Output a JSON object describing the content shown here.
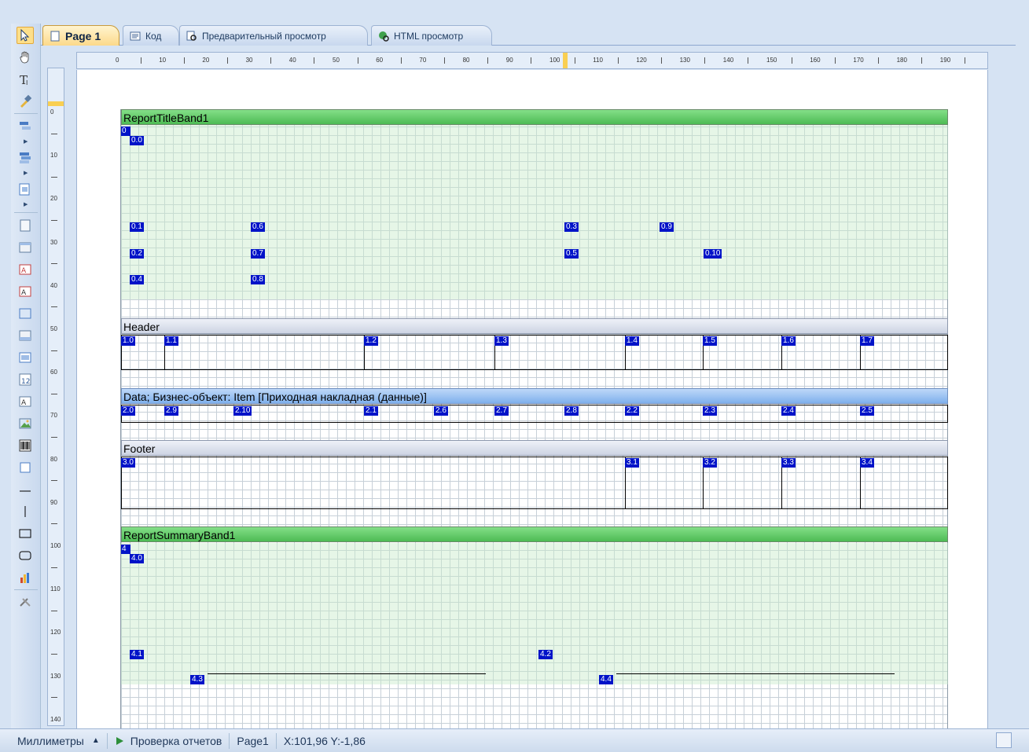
{
  "tabs": [
    {
      "label": "Page 1",
      "active": true
    },
    {
      "label": "Код"
    },
    {
      "label": "Предварительный просмотр"
    },
    {
      "label": "HTML просмотр"
    }
  ],
  "ruler": {
    "horizontal": [
      "0",
      "10",
      "20",
      "30",
      "40",
      "50",
      "60",
      "70",
      "80",
      "90",
      "100",
      "110",
      "120",
      "130",
      "140",
      "150",
      "160",
      "170",
      "180",
      "190"
    ],
    "vertical": [
      "0",
      "10",
      "20",
      "30",
      "40",
      "50",
      "60",
      "70",
      "80",
      "90",
      "100",
      "110",
      "120",
      "130",
      "140"
    ]
  },
  "bands": {
    "title": "ReportTitleBand1",
    "header": "Header",
    "data": "Data; Бизнес-объект: Item [Приходная накладная (данные)]",
    "footer": "Footer",
    "summary": "ReportSummaryBand1"
  },
  "labels": {
    "t_0": "0",
    "t_00": "0.0",
    "t_01": "0.1",
    "t_06": "0.6",
    "t_03": "0.3",
    "t_09": "0.9",
    "t_02": "0.2",
    "t_07": "0.7",
    "t_05": "0.5",
    "t_010": "0.10",
    "t_04": "0.4",
    "t_08": "0.8",
    "h_10": "1.0",
    "h_11": "1.1",
    "h_12": "1.2",
    "h_13": "1.3",
    "h_14": "1.4",
    "h_15": "1.5",
    "h_16": "1.6",
    "h_17": "1.7",
    "d_20": "2.0",
    "d_29": "2.9",
    "d_210": "2.10",
    "d_21": "2.1",
    "d_26": "2.6",
    "d_27": "2.7",
    "d_28": "2.8",
    "d_22": "2.2",
    "d_23": "2.3",
    "d_24": "2.4",
    "d_25": "2.5",
    "f_30": "3.0",
    "f_31": "3.1",
    "f_32": "3.2",
    "f_33": "3.3",
    "f_34": "3.4",
    "s_4": "4",
    "s_40": "4.0",
    "s_41": "4.1",
    "s_42": "4.2",
    "s_43": "4.3",
    "s_44": "4.4"
  },
  "statusbar": {
    "units": "Миллиметры",
    "check": "Проверка отчетов",
    "page": "Page1",
    "coords": "X:101,96  Y:-1,86"
  },
  "colors": {
    "band_green": "#4dbb54",
    "label_blue": "#0013c8",
    "active_tab": "#fcd98a"
  }
}
